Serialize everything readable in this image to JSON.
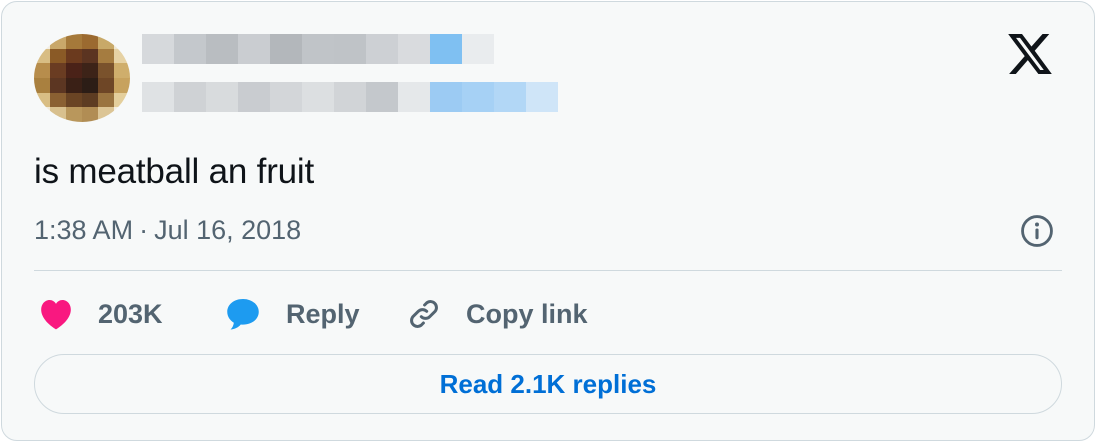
{
  "tweet": {
    "text": "is meatball an fruit",
    "time": "1:38 AM",
    "separator": "·",
    "date": "Jul 16, 2018"
  },
  "actions": {
    "likes_count": "203K",
    "reply_label": "Reply",
    "copy_label": "Copy link"
  },
  "read_replies_label": "Read 2.1K replies",
  "colors": {
    "like": "#f91880",
    "reply": "#1d9bf0",
    "link": "#006fd6",
    "muted": "#536471",
    "text": "#0f1419"
  },
  "icons": {
    "brand": "x-logo-icon",
    "info": "info-icon",
    "like": "heart-icon",
    "reply": "speech-bubble-icon",
    "copy": "link-icon"
  }
}
